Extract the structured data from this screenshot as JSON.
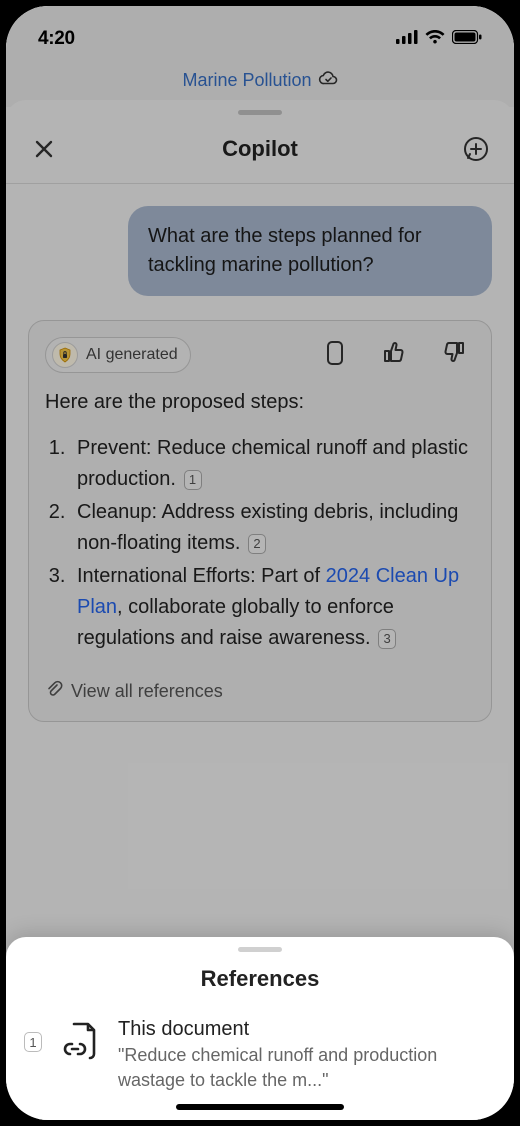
{
  "status": {
    "time": "4:20"
  },
  "doc": {
    "title": "Marine Pollution"
  },
  "copilot": {
    "title": "Copilot",
    "user_message": "What are the steps planned for tackling marine pollution?",
    "ai_badge": "AI generated",
    "intro": "Here are the proposed steps:",
    "steps": [
      {
        "text_prefix": "Prevent: Reduce chemical runoff and plastic production.",
        "citation": "1"
      },
      {
        "text_prefix": "Cleanup: Address existing debris, including non-floating items.",
        "citation": "2"
      },
      {
        "text_prefix": "International Efforts: Part of ",
        "link": "2024 Clean Up Plan",
        "text_suffix": ", collaborate globally to enforce regulations and raise awareness.",
        "citation": "3"
      }
    ],
    "view_all": "View all references"
  },
  "references": {
    "title": "References",
    "items": [
      {
        "num": "1",
        "title": "This document",
        "snippet": "\"Reduce chemical runoff and production wastage to tackle the m...\""
      }
    ]
  }
}
